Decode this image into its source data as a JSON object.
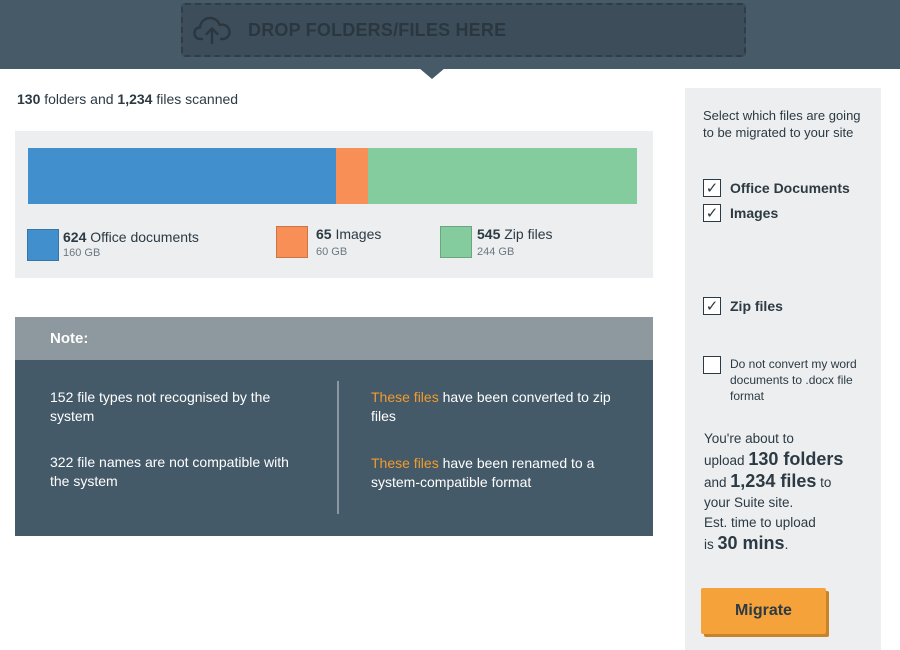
{
  "header": {
    "dropzone_label": "DROP FOLDERS/FILES HERE",
    "icon": "cloud-upload-icon"
  },
  "scan_summary": {
    "folders_count": "130",
    "folders_label": "folders and",
    "files_count": "1,234",
    "files_label": "files scanned"
  },
  "chart_data": {
    "type": "bar",
    "stacked": true,
    "orientation": "horizontal",
    "categories": [
      "Office documents",
      "Images",
      "Zip files"
    ],
    "values": [
      624,
      65,
      545
    ],
    "sizes": [
      "160 GB",
      "60 GB",
      "244 GB"
    ],
    "colors": [
      "#418fcd",
      "#f78f56",
      "#84cb9d"
    ],
    "title": "",
    "xlabel": "",
    "ylabel": "",
    "legend": "bottom"
  },
  "legend": [
    {
      "count": "624",
      "label": "Office documents",
      "size": "160 GB",
      "color": "#418fcd"
    },
    {
      "count": "65",
      "label": "Images",
      "size": "60 GB",
      "color": "#f78f56"
    },
    {
      "count": "545",
      "label": "Zip files",
      "size": "244 GB",
      "color": "#84cb9d"
    }
  ],
  "note": {
    "title": "Note:",
    "left": [
      "152 file types not recognised by the system",
      "322 file names are not compatible with the system"
    ],
    "right": [
      {
        "highlight": "These files",
        "text": " have been converted to zip files"
      },
      {
        "highlight": "These files",
        "text": " have been renamed to a system-compatible format"
      }
    ]
  },
  "sidebar": {
    "intro": "Select which files are going to be migrated to your site",
    "checkboxes": [
      {
        "label": "Office Documents",
        "checked": true
      },
      {
        "label": "Images",
        "checked": true
      },
      {
        "label": "Zip files",
        "checked": true
      }
    ],
    "convert_option": {
      "label": "Do not convert my word documents to .docx file format",
      "checked": false
    },
    "upload": {
      "line1": "You're about to",
      "upload_word": "upload",
      "folders": "130 folders",
      "and_word": "and",
      "files": "1,234 files",
      "to_word": "to",
      "line_site": "your Suite site.",
      "est_line": "Est. time to upload",
      "is_word": "is",
      "time": "30 mins",
      "period": "."
    },
    "migrate_label": "Migrate"
  },
  "colors": {
    "header": "#465a68",
    "accent": "#f6a23a",
    "note_bg": "#455a69",
    "highlight": "#f29b2c"
  }
}
